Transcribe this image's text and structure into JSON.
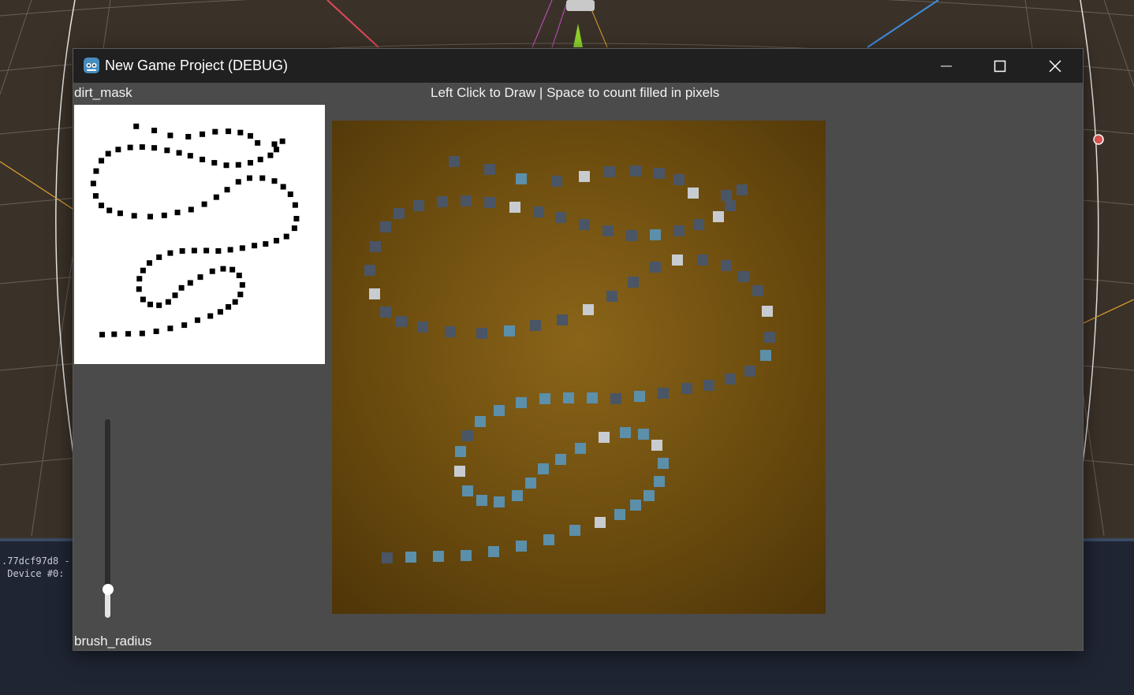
{
  "window": {
    "title": "New Game Project (DEBUG)",
    "icons": {
      "app": "godot-icon",
      "minimize": "minimize-icon",
      "maximize": "maximize-icon",
      "close": "close-icon"
    }
  },
  "labels": {
    "dirt_mask": "dirt_mask",
    "instructions": "Left Click to Draw | Space to count filled in pixels",
    "brush_radius": "brush_radius"
  },
  "slider": {
    "value": 0.12
  },
  "console": {
    "line1": ".77dcf97d8 -",
    "line2": " Device #0:"
  },
  "colors": {
    "dirt": "#6e4e0f",
    "stroke_blue": "#5b8faa",
    "stroke_slate": "#4a5566",
    "stroke_light": "#c8ccd0",
    "mask_ink": "#000000"
  }
}
